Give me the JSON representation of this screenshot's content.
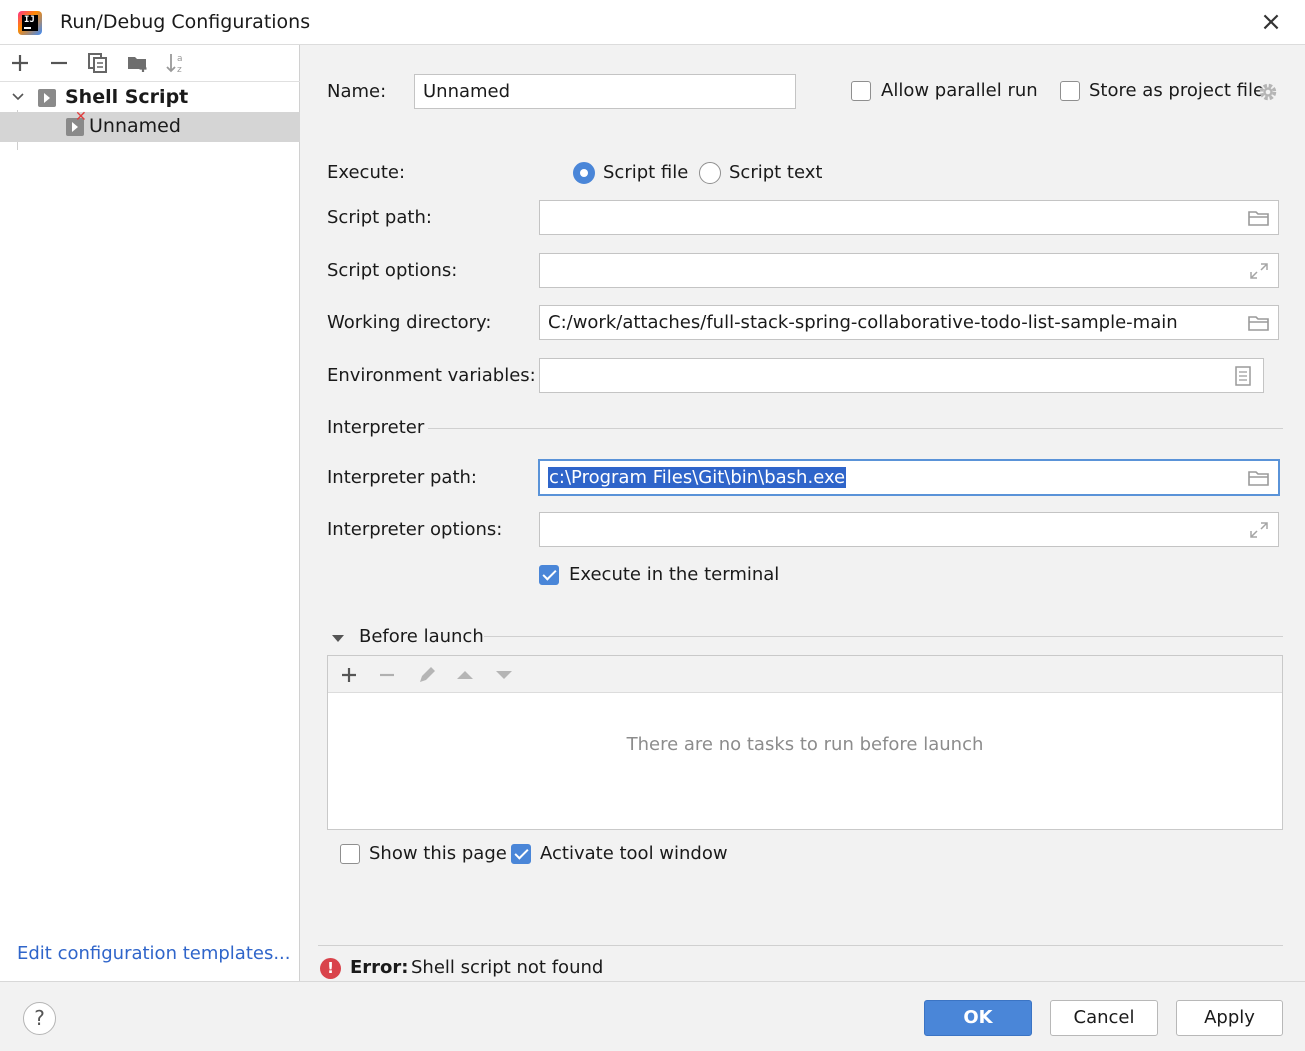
{
  "titlebar": {
    "title": "Run/Debug Configurations",
    "logo_text": "IJ",
    "close_icon": "close-icon"
  },
  "left": {
    "toolbar_icons": [
      "add-icon",
      "remove-icon",
      "copy-icon",
      "new-folder-icon",
      "sort-icon"
    ],
    "tree": [
      {
        "label": "Shell Script",
        "type": "group",
        "expanded": true
      },
      {
        "label": "Unnamed",
        "type": "configuration",
        "selected": true,
        "has_error": true
      }
    ],
    "edit_templates": "Edit configuration templates..."
  },
  "form": {
    "name_label": "Name:",
    "name_value": "Unnamed",
    "allow_parallel_label": "Allow parallel run",
    "allow_parallel_checked": false,
    "store_project_label": "Store as project file",
    "store_project_checked": false,
    "execute_label": "Execute:",
    "execute_options": [
      "Script file",
      "Script text"
    ],
    "execute_selected": "Script file",
    "script_path_label": "Script path:",
    "script_path_value": "",
    "script_options_label": "Script options:",
    "script_options_value": "",
    "working_dir_label": "Working directory:",
    "working_dir_value": "C:/work/attaches/full-stack-spring-collaborative-todo-list-sample-main",
    "env_vars_label": "Environment variables:",
    "env_vars_value": "",
    "interpreter_section": "Interpreter",
    "interpreter_path_label": "Interpreter path:",
    "interpreter_path_value": "c:\\Program Files\\Git\\bin\\bash.exe",
    "interpreter_options_label": "Interpreter options:",
    "interpreter_options_value": "",
    "execute_terminal_label": "Execute in the terminal",
    "execute_terminal_checked": true
  },
  "before_launch": {
    "title": "Before launch",
    "toolbar_icons": [
      "add-icon",
      "remove-icon",
      "edit-icon",
      "move-up-icon",
      "move-down-icon"
    ],
    "empty_text": "There are no tasks to run before launch",
    "show_page_label": "Show this page",
    "show_page_checked": false,
    "activate_tool_label": "Activate tool window",
    "activate_tool_checked": true
  },
  "error": {
    "prefix": "Error:",
    "message": "Shell script not found"
  },
  "footer": {
    "help": "?",
    "ok": "OK",
    "cancel": "Cancel",
    "apply": "Apply"
  },
  "colors": {
    "accent": "#4a86d8",
    "error": "#d9434b",
    "link": "#2f65ca"
  }
}
